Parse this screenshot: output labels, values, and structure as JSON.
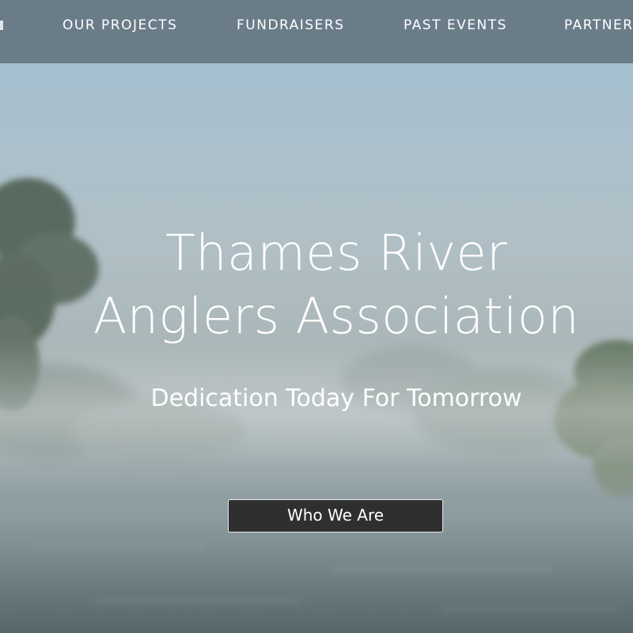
{
  "nav": {
    "items": [
      {
        "label": "OUR PROJECTS"
      },
      {
        "label": "FUNDRAISERS"
      },
      {
        "label": "PAST EVENTS"
      },
      {
        "label": "PARTNERS"
      }
    ]
  },
  "hero": {
    "title_line1": "Thames River",
    "title_line2": "Anglers Association",
    "subtitle": "Dedication Today For Tomorrow",
    "cta_label": "Who We Are"
  },
  "colors": {
    "navbar": "#667682",
    "button_bg": "#2f2f2f",
    "text": "#ffffff"
  }
}
